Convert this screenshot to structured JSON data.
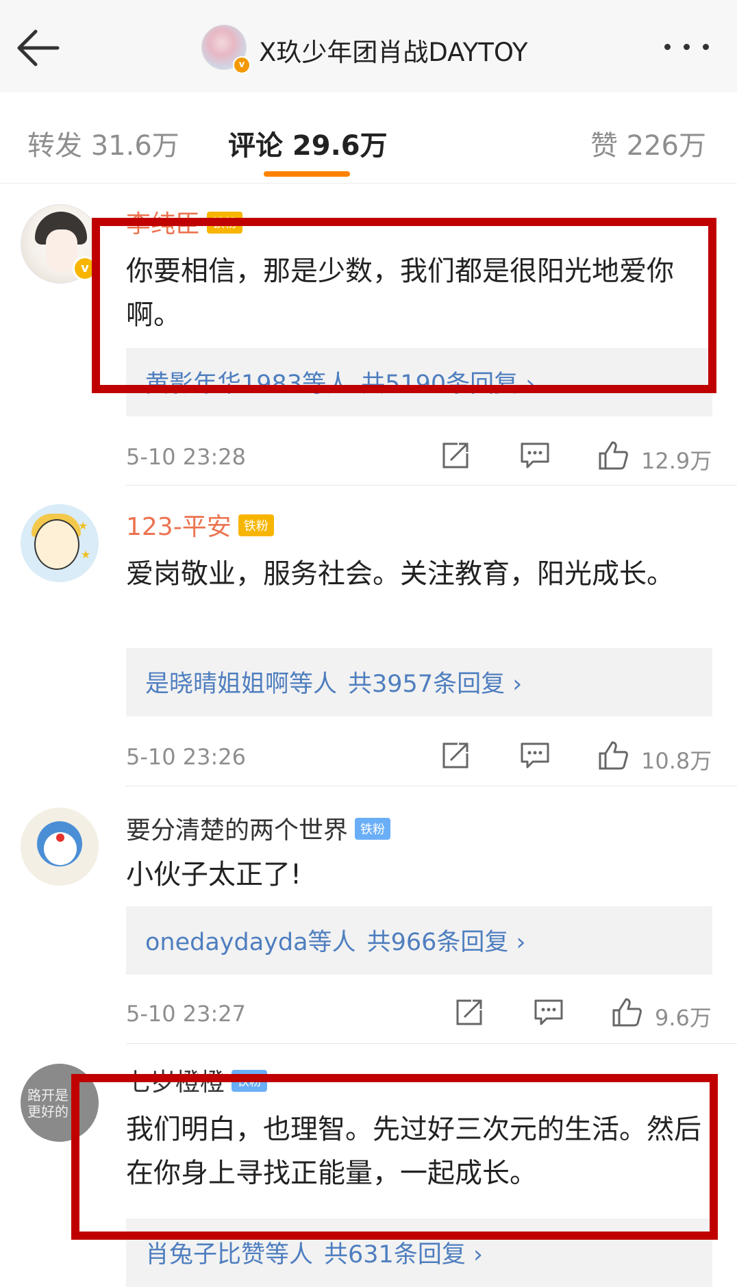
{
  "header": {
    "title": "X玖少年团肖战DAYTOY",
    "back_icon": "back-arrow-icon",
    "more_icon": "more-dots-icon",
    "verified_mark": "v"
  },
  "tabs": {
    "repost": "转发 31.6万",
    "comment": "评论 29.6万",
    "like": "赞 226万",
    "active_color": "#ff8200"
  },
  "comments": [
    {
      "user": "李纯臣",
      "badge": "铁粉",
      "verified_mark": "v",
      "text": "你要相信，那是少数，我们都是很阳光地爱你啊。",
      "reply_users": "黄影年华1983等人",
      "reply_count": "共5190条回复 ›",
      "time": "5-10 23:28",
      "likes": "12.9万"
    },
    {
      "user": "123-平安",
      "badge": "铁粉",
      "text": "爱岗敬业，服务社会。关注教育，阳光成长。",
      "reply_users": "是晓晴姐姐啊等人",
      "reply_count": "共3957条回复 ›",
      "time": "5-10 23:26",
      "likes": "10.8万"
    },
    {
      "user": "要分清楚的两个世界",
      "badge": "铁粉",
      "text": "小伙子太正了!",
      "reply_users": "onedaydayda等人",
      "reply_count": "共966条回复 ›",
      "time": "5-10 23:27",
      "likes": "9.6万"
    },
    {
      "user": "七岁橙橙",
      "badge": "铁粉",
      "avatar_scrawl": "路开是\n更好的",
      "text": "我们明白，也理智。先过好三次元的生活。然后在你身上寻找正能量，一起成长。",
      "reply_users": "肖兔子比赞等人",
      "reply_count": "共631条回复 ›"
    }
  ],
  "colors": {
    "username_orange": "#eb7350",
    "link_blue": "#4e7ebf",
    "annotation_red": "#c00000"
  }
}
